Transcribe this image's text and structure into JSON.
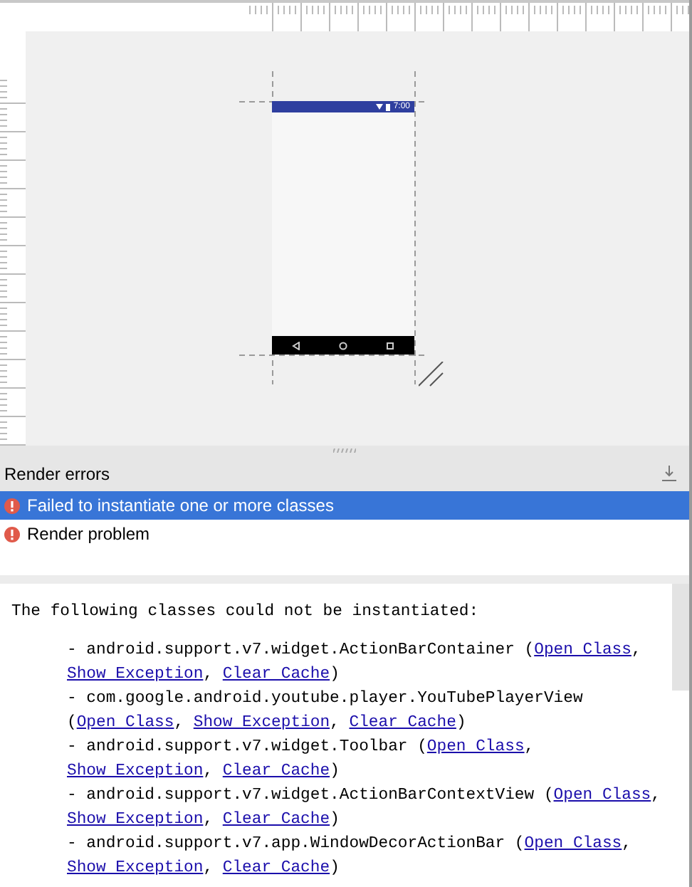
{
  "device_preview": {
    "status_time": "7:00"
  },
  "render_errors": {
    "title": "Render errors",
    "issues": [
      {
        "label": "Failed to instantiate one or more classes",
        "selected": true
      },
      {
        "label": "Render problem",
        "selected": false
      }
    ]
  },
  "details": {
    "heading": "The following classes could not be instantiated:",
    "items": [
      {
        "text": "- android.support.v7.widget.ActionBarContainer (",
        "links": [
          {
            "label": "Open Class",
            "after": ", "
          },
          {
            "label": "Show Exception",
            "after": ", "
          },
          {
            "label": "Clear Cache",
            "after": ")"
          }
        ]
      },
      {
        "text": "- com.google.android.youtube.player.YouTubePlayerView (",
        "links": [
          {
            "label": "Open Class",
            "after": ", "
          },
          {
            "label": "Show Exception",
            "after": ", "
          },
          {
            "label": "Clear Cache",
            "after": ")"
          }
        ]
      },
      {
        "text": "- android.support.v7.widget.Toolbar (",
        "links": [
          {
            "label": "Open Class",
            "after": ", "
          },
          {
            "label": "Show Exception",
            "after": ", "
          },
          {
            "label": "Clear Cache",
            "after": ")"
          }
        ]
      },
      {
        "text": "- android.support.v7.widget.ActionBarContextView (",
        "links": [
          {
            "label": "Open Class",
            "after": ", "
          },
          {
            "label": "Show Exception",
            "after": ", "
          },
          {
            "label": "Clear Cache",
            "after": ")"
          }
        ]
      },
      {
        "text": "- android.support.v7.app.WindowDecorActionBar (",
        "links": [
          {
            "label": "Open Class",
            "after": ", "
          },
          {
            "label": "Show Exception",
            "after": ", "
          },
          {
            "label": "Clear Cache",
            "after": ")"
          }
        ]
      }
    ]
  }
}
